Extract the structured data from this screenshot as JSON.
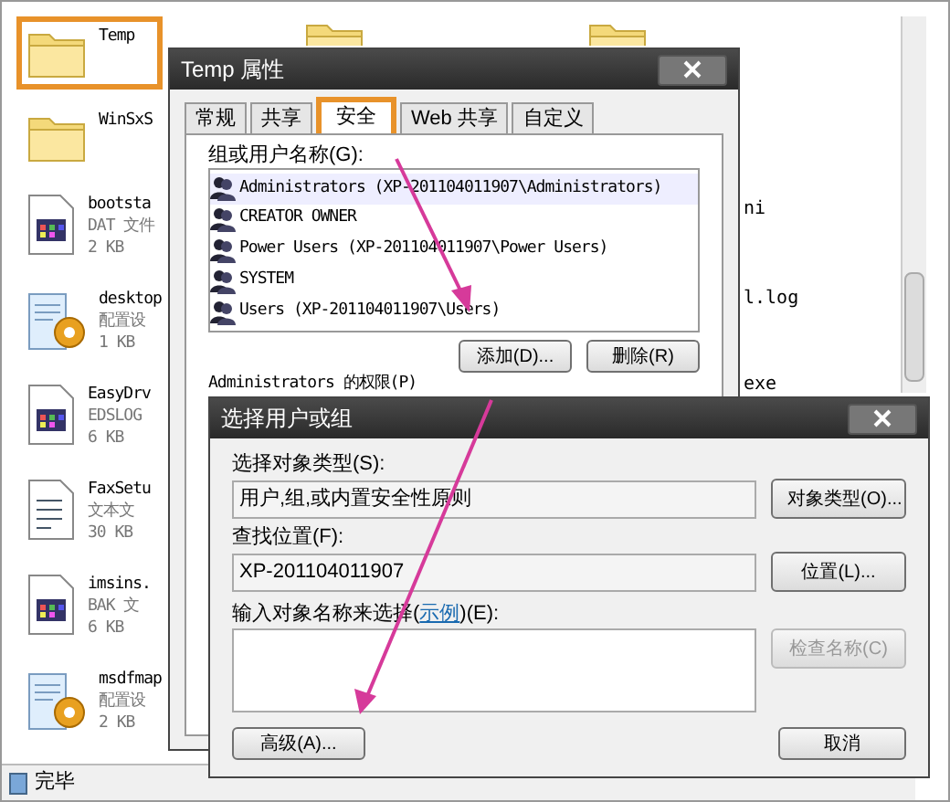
{
  "explorer": {
    "files": [
      {
        "kind": "folder",
        "name": "Temp",
        "selected": true
      },
      {
        "kind": "folder",
        "name": "WinSxS",
        "selected": false
      },
      {
        "kind": "app",
        "name": "bootsta",
        "type": "DAT 文件",
        "size": "2 KB",
        "selected": false
      },
      {
        "kind": "config",
        "name": "desktop",
        "type": "配置设",
        "size": "1 KB",
        "selected": false
      },
      {
        "kind": "app",
        "name": "EasyDrv",
        "type": "EDSLOG",
        "size": "6 KB",
        "selected": false
      },
      {
        "kind": "text",
        "name": "FaxSetu",
        "type": "文本文",
        "size": "30 KB",
        "selected": false
      },
      {
        "kind": "app",
        "name": "imsins.",
        "type": "BAK 文",
        "size": "6 KB",
        "selected": false
      },
      {
        "kind": "config",
        "name": "msdfmap",
        "type": "配置设",
        "size": "2 KB",
        "selected": false
      }
    ],
    "partial_labels": [
      "ni",
      "l.log",
      "exe"
    ],
    "status_bar": "完毕"
  },
  "properties_dialog": {
    "title": "Temp 属性",
    "tabs": [
      {
        "label": "常规",
        "selected": false
      },
      {
        "label": "共享",
        "selected": false
      },
      {
        "label": "安全",
        "selected": true
      },
      {
        "label": "Web 共享",
        "selected": false
      },
      {
        "label": "自定义",
        "selected": false
      }
    ],
    "group_label": "组或用户名称(G):",
    "users": [
      {
        "name": "Administrators (XP-201104011907\\Administrators)",
        "selected": true
      },
      {
        "name": "CREATOR OWNER",
        "selected": false
      },
      {
        "name": "Power Users (XP-201104011907\\Power Users)",
        "selected": false
      },
      {
        "name": "SYSTEM",
        "selected": false
      },
      {
        "name": "Users (XP-201104011907\\Users)",
        "selected": false
      }
    ],
    "buttons": [
      "添加(D)...",
      "删除(R)"
    ],
    "permissions_label": "Administrators 的权限(P)"
  },
  "select_dialog": {
    "title": "选择用户或组",
    "object_type_label": "选择对象类型(S):",
    "object_type_value": "用户,组,或内置安全性原则",
    "object_type_button": "对象类型(O)...",
    "location_label": "查找位置(F):",
    "location_value": "XP-201104011907",
    "location_button": "位置(L)...",
    "names_label": "输入对象名称来选择(",
    "names_link": "示例",
    "names_label_end": ")(E):",
    "check_button": {
      "label": "检查名称(C)",
      "disabled": true
    },
    "advanced_button": "高级(A)...",
    "cancel_button": "取消"
  }
}
